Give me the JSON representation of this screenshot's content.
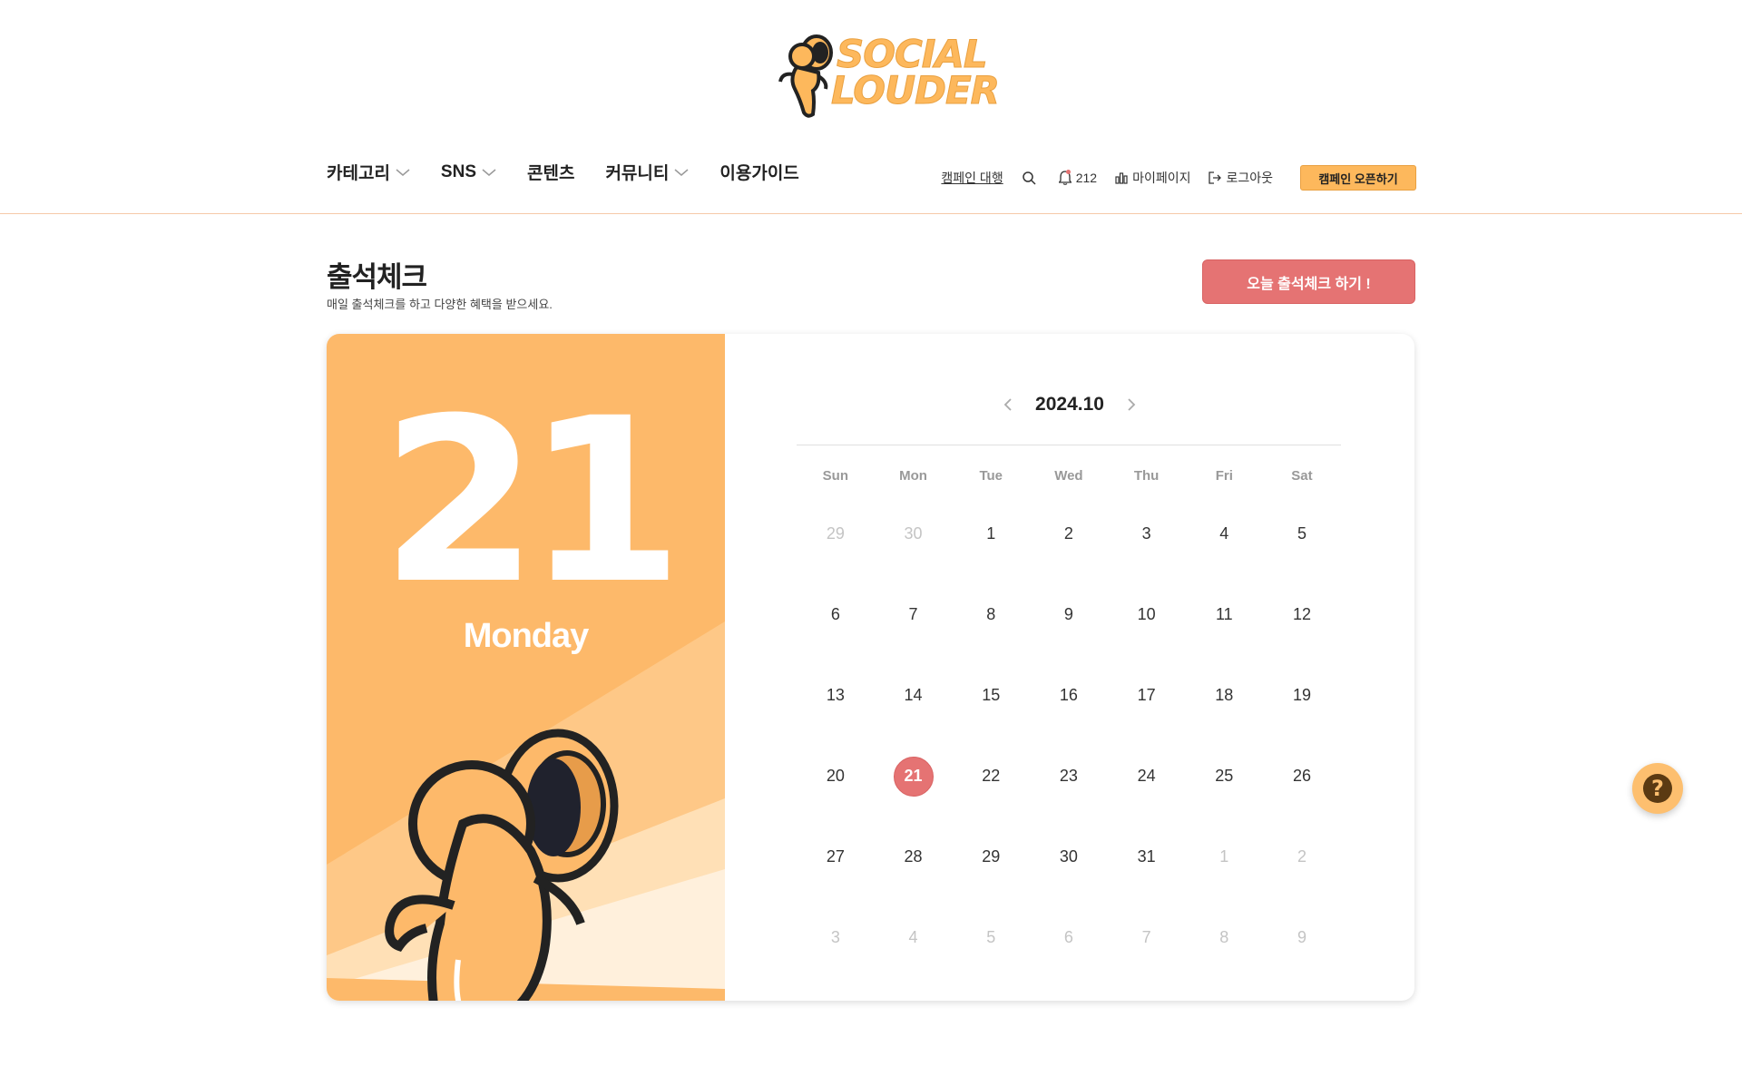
{
  "brand": {
    "line1": "SOCIAL",
    "line2": "LOUDER",
    "icon": "astronaut-logo-icon"
  },
  "nav": {
    "items": [
      {
        "label": "카테고리",
        "has_dropdown": true
      },
      {
        "label": "SNS",
        "has_dropdown": true
      },
      {
        "label": "콘텐츠",
        "has_dropdown": false
      },
      {
        "label": "커뮤니티",
        "has_dropdown": true
      },
      {
        "label": "이용가이드",
        "has_dropdown": false
      }
    ]
  },
  "utility": {
    "campaign_agency": "캠페인 대행",
    "search_icon": "search-icon",
    "notification_count": "212",
    "mypage": "마이페이지",
    "logout": "로그아웃",
    "open_campaign": "캠페인 오픈하기"
  },
  "page": {
    "title": "출석체크",
    "subtitle": "매일 출석체크를 하고 다양한 혜택을 받으세요.",
    "check_button": "오늘 출석체크 하기 !"
  },
  "today": {
    "day": "21",
    "weekday": "Monday"
  },
  "calendar": {
    "month_label": "2024.10",
    "weekdays": [
      "Sun",
      "Mon",
      "Tue",
      "Wed",
      "Thu",
      "Fri",
      "Sat"
    ],
    "weeks": [
      [
        {
          "d": "29",
          "m": true
        },
        {
          "d": "30",
          "m": true
        },
        {
          "d": "1"
        },
        {
          "d": "2"
        },
        {
          "d": "3"
        },
        {
          "d": "4"
        },
        {
          "d": "5"
        }
      ],
      [
        {
          "d": "6"
        },
        {
          "d": "7"
        },
        {
          "d": "8"
        },
        {
          "d": "9"
        },
        {
          "d": "10"
        },
        {
          "d": "11"
        },
        {
          "d": "12"
        }
      ],
      [
        {
          "d": "13"
        },
        {
          "d": "14"
        },
        {
          "d": "15"
        },
        {
          "d": "16"
        },
        {
          "d": "17"
        },
        {
          "d": "18"
        },
        {
          "d": "19"
        }
      ],
      [
        {
          "d": "20"
        },
        {
          "d": "21",
          "today": true
        },
        {
          "d": "22"
        },
        {
          "d": "23"
        },
        {
          "d": "24"
        },
        {
          "d": "25"
        },
        {
          "d": "26"
        }
      ],
      [
        {
          "d": "27"
        },
        {
          "d": "28"
        },
        {
          "d": "29"
        },
        {
          "d": "30"
        },
        {
          "d": "31"
        },
        {
          "d": "1",
          "m": true
        },
        {
          "d": "2",
          "m": true
        }
      ],
      [
        {
          "d": "3",
          "m": true
        },
        {
          "d": "4",
          "m": true
        },
        {
          "d": "5",
          "m": true
        },
        {
          "d": "6",
          "m": true
        },
        {
          "d": "7",
          "m": true
        },
        {
          "d": "8",
          "m": true
        },
        {
          "d": "9",
          "m": true
        }
      ]
    ]
  },
  "colors": {
    "brand_orange": "#fdb96a",
    "accent_red": "#e57373",
    "help_brown": "#5b3a12"
  }
}
